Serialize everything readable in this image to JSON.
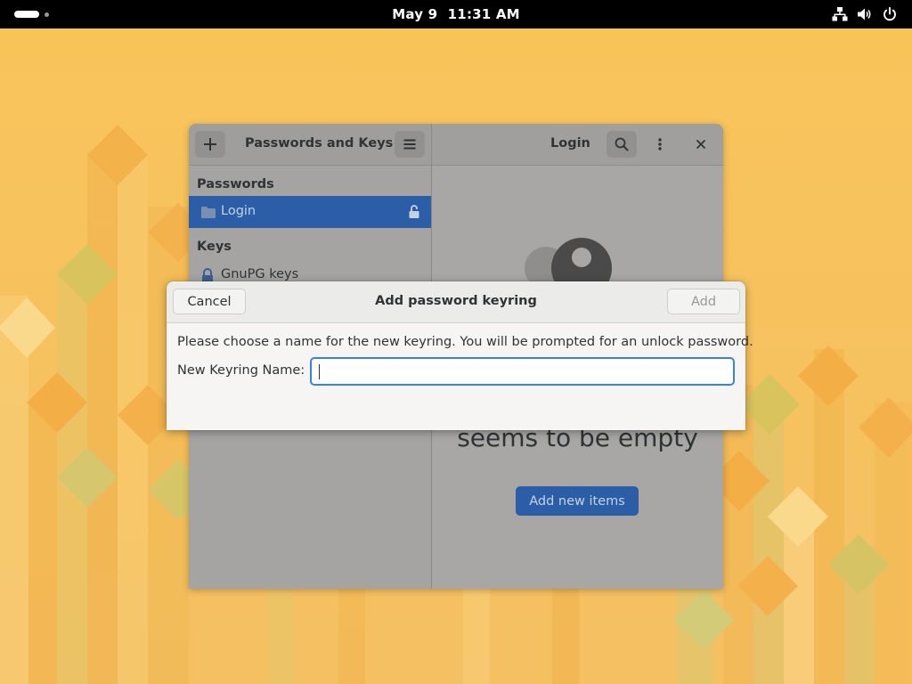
{
  "topbar": {
    "date": "May 9",
    "time": "11:31 AM",
    "activities_icon": "activities-icon",
    "tray_icons": [
      "network-wired-icon",
      "volume-icon",
      "power-icon"
    ]
  },
  "main_window": {
    "sidebar": {
      "add_button_icon": "plus-icon",
      "title": "Passwords and Keys",
      "menu_button_icon": "hamburger-menu-icon",
      "passwords_label": "Passwords",
      "login_item": {
        "label": "Login",
        "icon": "folder-icon",
        "lock_icon": "unlocked-padlock-icon",
        "selected": true
      },
      "keys_label": "Keys",
      "gnupg_item": {
        "label": "GnuPG keys",
        "icon": "gnupg-key-icon"
      }
    },
    "content": {
      "title": "Login",
      "search_icon": "search-icon",
      "more_icon": "vertical-ellipsis-icon",
      "close_icon": "close-icon",
      "empty_text": "seems to be empty",
      "add_new_items_label": "Add new items"
    }
  },
  "dialog": {
    "title": "Add password keyring",
    "cancel_label": "Cancel",
    "add_label": "Add",
    "add_enabled": false,
    "description": "Please choose a name for the new keyring. You will be prompted for an unlock password.",
    "field_label": "New Keyring Name:",
    "field_value": ""
  },
  "colors": {
    "accent": "#3584e4",
    "selection": "#2b5ea7",
    "wallpaper": "#f6c25f"
  }
}
